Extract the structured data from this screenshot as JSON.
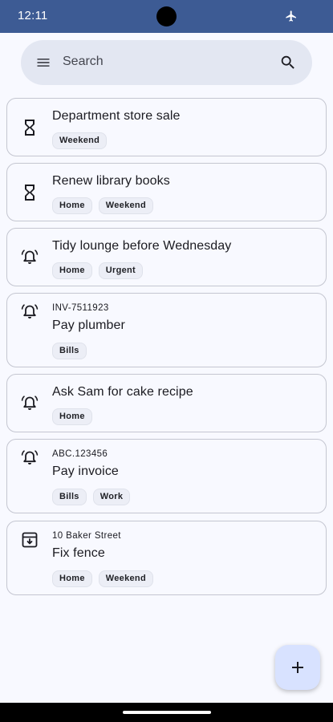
{
  "status_bar": {
    "time": "12:11",
    "icons": [
      "airplane-mode-icon"
    ],
    "color": "#3d5b94"
  },
  "search": {
    "placeholder": "Search",
    "menu_icon": "menu-icon",
    "search_icon": "search-icon"
  },
  "reminders": [
    {
      "icon": "hourglass-icon",
      "subtitle": "",
      "title": "Department store sale",
      "labels": [
        "Weekend"
      ]
    },
    {
      "icon": "hourglass-icon",
      "subtitle": "",
      "title": "Renew library books",
      "labels": [
        "Home",
        "Weekend"
      ]
    },
    {
      "icon": "alarm-bell-icon",
      "subtitle": "",
      "title": "Tidy lounge before Wednesday",
      "labels": [
        "Home",
        "Urgent"
      ]
    },
    {
      "icon": "alarm-bell-icon",
      "subtitle": "INV-7511923",
      "title": "Pay plumber",
      "labels": [
        "Bills"
      ]
    },
    {
      "icon": "alarm-bell-icon",
      "subtitle": "",
      "title": "Ask Sam for cake recipe",
      "labels": [
        "Home"
      ]
    },
    {
      "icon": "alarm-bell-icon",
      "subtitle": "ABC.123456",
      "title": "Pay invoice",
      "labels": [
        "Bills",
        "Work"
      ]
    },
    {
      "icon": "archive-icon",
      "subtitle": "10 Baker Street",
      "title": "Fix fence",
      "labels": [
        "Home",
        "Weekend"
      ]
    }
  ],
  "fab": {
    "icon": "plus-icon",
    "color": "#d8e2ff"
  }
}
